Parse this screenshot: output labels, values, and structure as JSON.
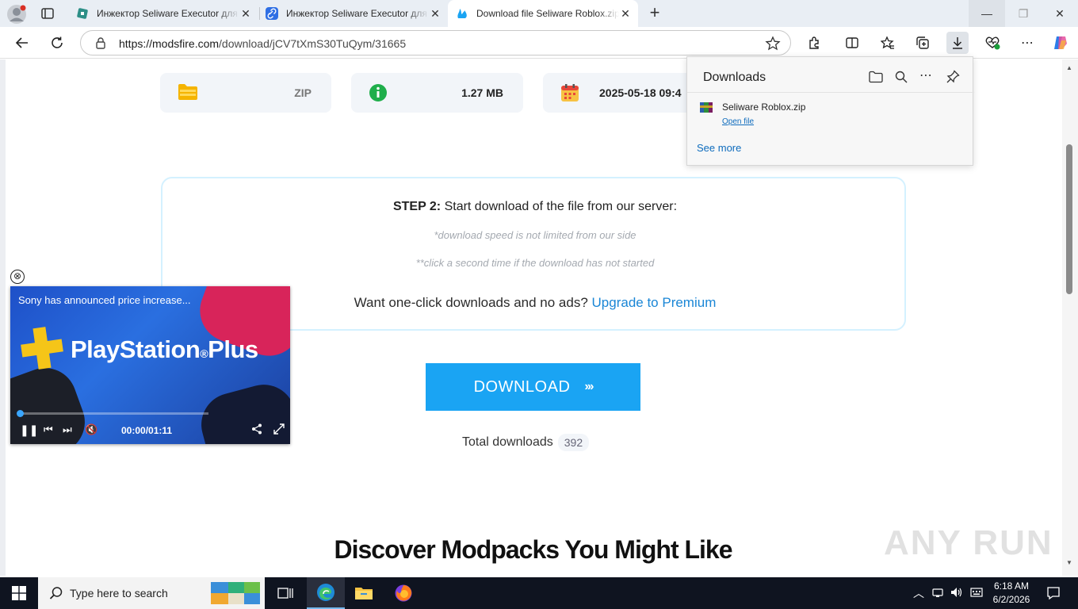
{
  "browser": {
    "tabs": [
      {
        "title": "Инжектор Seliware Executor для"
      },
      {
        "title": "Инжектор Seliware Executor для"
      },
      {
        "title": "Download file Seliware Roblox.zip"
      }
    ],
    "url_domain": "https://modsfire.com",
    "url_path": "/download/jCV7tXmS30TuQym/31665"
  },
  "page": {
    "file_type": "ZIP",
    "file_size": "1.27 MB",
    "file_date": "2025-05-18 09:4",
    "step_label": "STEP 2:",
    "step_text": " Start download of the file from our server:",
    "note1": "*download speed is not limited from our side",
    "note2": "**click a second time if the download has not started",
    "premium_text": "Want one-click downloads and no ads? ",
    "premium_link": "Upgrade to Premium",
    "download_button": "DOWNLOAD",
    "download_arrows": "›››",
    "total_label": "Total downloads",
    "total_count": "392",
    "discover_title": "Discover Modpacks You Might Like"
  },
  "ad": {
    "close": "⊗",
    "caption": "Sony has announced price increase...",
    "brand": "PlayStation",
    "brand_reg": "®",
    "brand_suffix": "Plus",
    "time": "00:00/01:11"
  },
  "downloads_panel": {
    "title": "Downloads",
    "file_name": "Seliware Roblox.zip",
    "open_file": "Open file",
    "see_more": "See more"
  },
  "watermark": "ANY RUN",
  "taskbar": {
    "search_placeholder": "Type here to search",
    "time": "6:18 AM",
    "date": "6/2/2026"
  },
  "colors": {
    "accent": "#1aa4f3",
    "link": "#1a86d6",
    "step_border": "#d4f1ff"
  }
}
